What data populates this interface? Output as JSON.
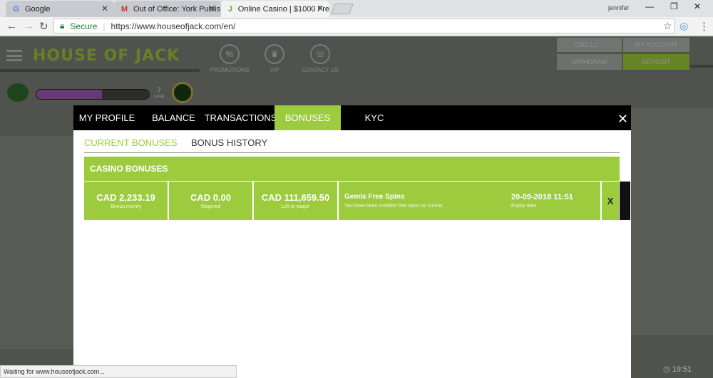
{
  "browser": {
    "tabs": [
      {
        "title": "Google",
        "icon": "google-icon"
      },
      {
        "title": "Out of Office: York Publis",
        "icon": "gmail-icon"
      },
      {
        "title": "Online Casino | $1000 Fre",
        "icon": "houseofjack-icon"
      }
    ],
    "user": "jennifer",
    "secure_label": "Secure",
    "url": "https://www.houseofjack.com/en/"
  },
  "site": {
    "logo_text": "HOUSE OF JACK",
    "nav": [
      {
        "label": "PROMOTIONS",
        "glyph": "%"
      },
      {
        "label": "VIP",
        "glyph": "♛"
      },
      {
        "label": "CONTACT US",
        "glyph": "☏"
      }
    ],
    "header_buttons": {
      "balance": "CAD 2,2…",
      "account": "MY ACCOUNT",
      "withdraw": "WITHDRAW",
      "deposit": "DEPOSIT"
    },
    "level_value": "7",
    "level_label": "Level",
    "progress_fraction": 0.58,
    "clock": "19:51"
  },
  "modal": {
    "tabs": [
      "MY PROFILE",
      "BALANCE",
      "TRANSACTIONS",
      "BONUSES",
      "KYC"
    ],
    "active_tab": "BONUSES",
    "close_glyph": "✕",
    "subtabs": {
      "current": "CURRENT BONUSES",
      "history": "BONUS HISTORY"
    },
    "section_title": "CASINO BONUSES",
    "bonus": {
      "bonus_money": "CAD 2,233.19",
      "bonus_money_label": "Bonus money",
      "wagered": "CAD 0.00",
      "wagered_label": "Wagered",
      "left_to_wager": "CAD 111,659.50",
      "left_to_wager_label": "Left to wager",
      "name": "Gemix Free Spins",
      "description": "You have been credited free spins on Gemix.",
      "expiry": "20-09-2018 11:51",
      "expiry_label": "Expiry date",
      "remove": "X"
    }
  },
  "statusbar": {
    "text": "Waiting for www.houseofjack.com..."
  },
  "colors": {
    "accent": "#9ccc3e",
    "modal_tabbar": "#000000"
  }
}
